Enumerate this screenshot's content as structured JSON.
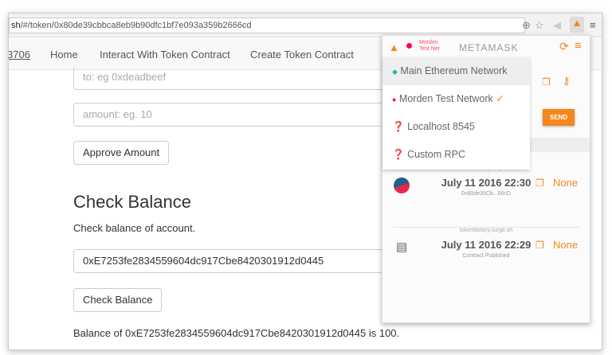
{
  "browser": {
    "url_prefix": "sh",
    "url_path": "/#/token/0x80de39cbbca8eb9b90dfc1bf7e093a359b2666cd"
  },
  "nav": {
    "brand_fragment": "3706",
    "items": [
      "Home",
      "Interact With Token Contract",
      "Create Token Contract"
    ]
  },
  "form": {
    "to_placeholder": "to: eg 0xdeadbeef",
    "amount_placeholder": "amount: eg. 10",
    "approve_label": "Approve Amount"
  },
  "balance": {
    "title": "Check Balance",
    "description": "Check balance of account.",
    "address_value": "0xE7253fe2834559604dc917Cbe8420301912d0445",
    "button_label": "Check Balance",
    "result": "Balance of 0xE7253fe2834559604dc917Cbe8420301912d0445 is 100."
  },
  "metamask": {
    "title": "METAMASK",
    "network_badge_line1": "Morden",
    "network_badge_line2": "Test Net",
    "send_label": "SEND",
    "networks": [
      {
        "label": "Main Ethereum Network",
        "color": "#29b6af"
      },
      {
        "label": "Morden Test Network",
        "color": "#ff0055",
        "check": "✓"
      },
      {
        "label": "Localhost 8545"
      },
      {
        "label": "Custom RPC"
      }
    ],
    "transactions": [
      {
        "site": "tokenfactory.surge.sh",
        "date": "July 11 2016 22:30",
        "sub": "0x80de39Cb...66cD",
        "value": "None"
      },
      {
        "site": "tokenfactory.surge.sh",
        "date": "July 11 2016 22:29",
        "sub": "Contract Published",
        "value": "None"
      }
    ]
  },
  "colors": {
    "accent": "#f7861c"
  }
}
